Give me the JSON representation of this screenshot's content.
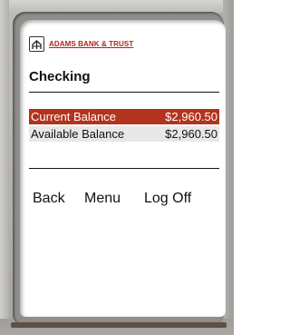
{
  "header": {
    "logo_icon": "bank-logo-icon",
    "bank_name": "ADAMS BANK & TRUST"
  },
  "account": {
    "title": "Checking"
  },
  "balances": [
    {
      "label": "Current Balance",
      "value": "$2,960.50",
      "selected": true
    },
    {
      "label": "Available Balance",
      "value": "$2,960.50",
      "selected": false
    }
  ],
  "nav": {
    "back": "Back",
    "menu": "Menu",
    "logoff": "Log Off"
  },
  "colors": {
    "accent": "#b2331e",
    "brand_text": "#b32416",
    "row_alt": "#e8e8e8"
  }
}
